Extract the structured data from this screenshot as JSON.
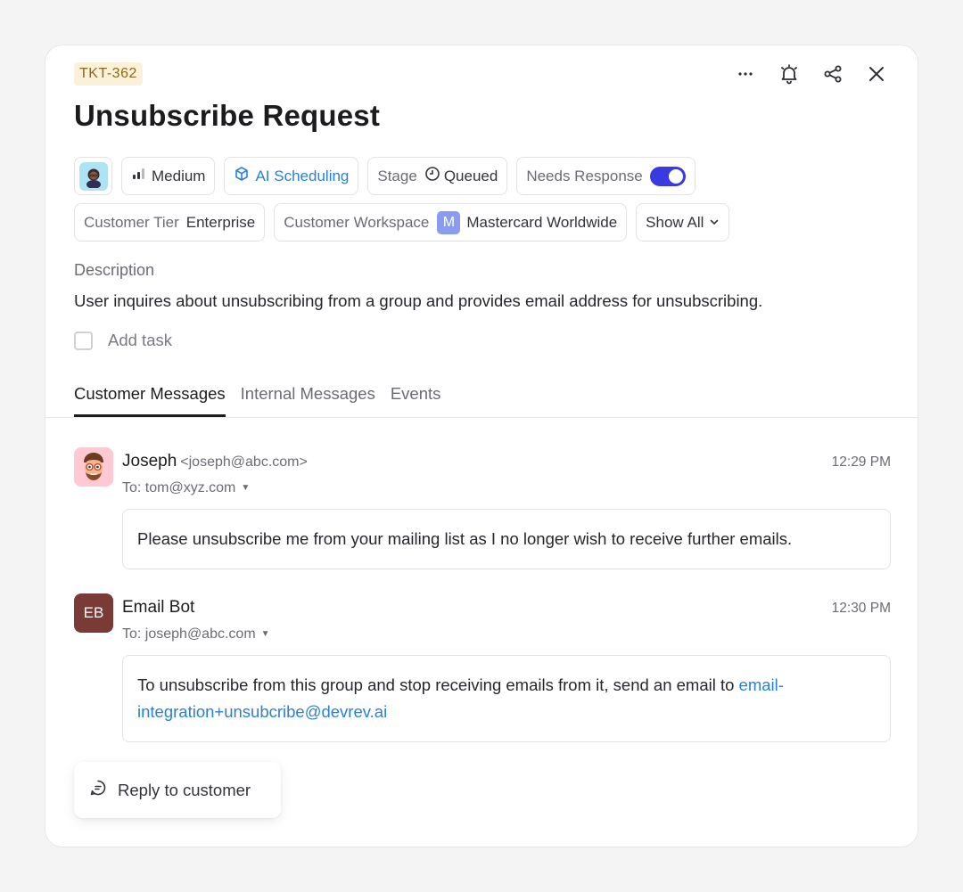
{
  "ticket": {
    "id": "TKT-362",
    "title": "Unsubscribe Request",
    "priority": "Medium",
    "scheduling": "AI Scheduling",
    "stage_label": "Stage",
    "stage_value": "Queued",
    "needs_response_label": "Needs Response",
    "needs_response_on": true,
    "tier_label": "Customer Tier",
    "tier_value": "Enterprise",
    "workspace_label": "Customer Workspace",
    "workspace_badge": "M",
    "workspace_value": "Mastercard Worldwide",
    "show_all": "Show All",
    "description_label": "Description",
    "description": "User inquires about unsubscribing from a group and provides email address for unsubscribing.",
    "add_task": "Add task"
  },
  "header_icons": [
    "more-icon",
    "bell-icon",
    "share-icon",
    "close-icon"
  ],
  "tabs": [
    {
      "label": "Customer Messages",
      "active": true
    },
    {
      "label": "Internal Messages",
      "active": false
    },
    {
      "label": "Events",
      "active": false
    }
  ],
  "messages": [
    {
      "sender": "Joseph",
      "sender_email": "<joseph@abc.com>",
      "time": "12:29 PM",
      "to": "To: tom@xyz.com",
      "body": "Please unsubscribe me from your mailing list as I no longer wish to receive further emails."
    },
    {
      "sender": "Email Bot",
      "initials": "EB",
      "time": "12:30 PM",
      "to": "To: joseph@abc.com",
      "body": "To unsubscribe from this group and stop receiving emails from it, send an email to ",
      "link": "email-integration+unsubcribe@devrev.ai"
    }
  ],
  "reply_label": "Reply to customer",
  "colors": {
    "accent": "#3a3ae0",
    "link": "#2b7fd6",
    "ticket_badge_bg": "#fbf1d8",
    "bot_avatar": "#7a3a36",
    "workspace_badge": "#8b9cf0"
  }
}
